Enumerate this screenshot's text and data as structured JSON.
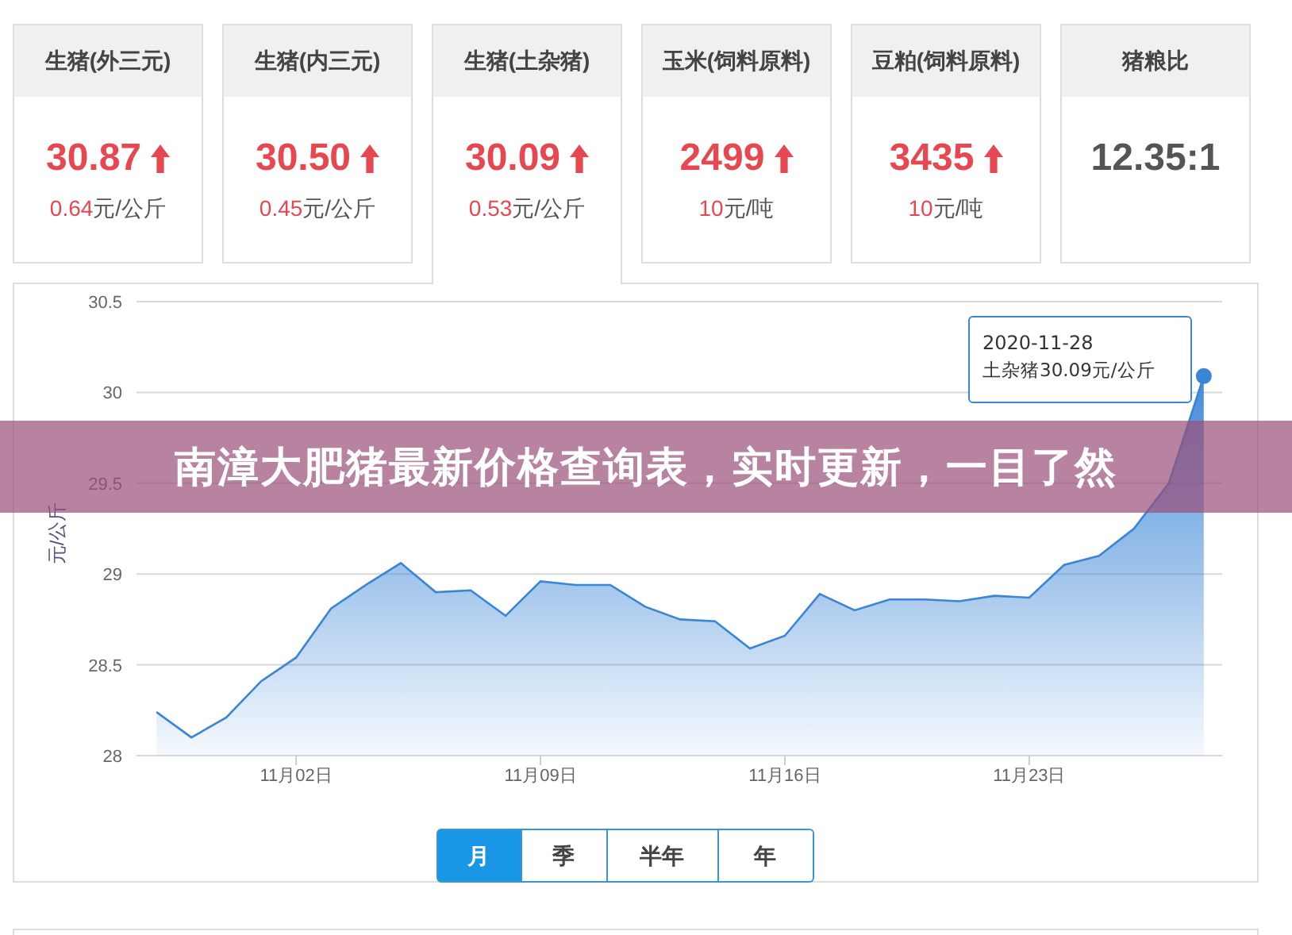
{
  "cards": [
    {
      "title": "生猪(外三元)",
      "value": "30.87",
      "kind": "up",
      "change": "0.64",
      "unit": "元/公斤",
      "selected": false
    },
    {
      "title": "生猪(内三元)",
      "value": "30.50",
      "kind": "up",
      "change": "0.45",
      "unit": "元/公斤",
      "selected": false
    },
    {
      "title": "生猪(土杂猪)",
      "value": "30.09",
      "kind": "up",
      "change": "0.53",
      "unit": "元/公斤",
      "selected": true
    },
    {
      "title": "玉米(饲料原料)",
      "value": "2499",
      "kind": "up",
      "change": "10",
      "unit": "元/吨",
      "selected": false
    },
    {
      "title": "豆粕(饲料原料)",
      "value": "3435",
      "kind": "up",
      "change": "10",
      "unit": "元/吨",
      "selected": false
    },
    {
      "title": "猪粮比",
      "value": "12.35:1",
      "kind": "none",
      "selected": false
    }
  ],
  "chart": {
    "tooltip": {
      "date": "2020-11-28",
      "text": "土杂猪30.09元/公斤"
    },
    "chart_data": {
      "type": "area",
      "ylabel": "元/公斤",
      "categories": [
        null,
        null,
        null,
        null,
        "11月02日",
        null,
        null,
        null,
        null,
        null,
        null,
        "11月09日",
        null,
        null,
        null,
        null,
        null,
        null,
        "11月16日",
        null,
        null,
        null,
        null,
        null,
        null,
        "11月23日",
        null,
        null,
        null,
        null,
        null
      ],
      "series": [
        {
          "color": "#3a85d6",
          "values": [
            28.24,
            28.1,
            28.21,
            28.41,
            28.54,
            28.81,
            28.94,
            29.06,
            28.9,
            28.91,
            28.77,
            28.96,
            28.94,
            28.94,
            28.82,
            28.75,
            28.74,
            28.59,
            28.66,
            28.89,
            28.8,
            28.86,
            28.86,
            28.85,
            28.88,
            28.87,
            29.05,
            29.1,
            29.25,
            29.5,
            30.09
          ]
        }
      ],
      "ylim": [
        28,
        30.5
      ],
      "grid": true,
      "yticks": [
        {
          "value": 28,
          "label": "28"
        },
        {
          "value": 28.5,
          "label": "28.5"
        },
        {
          "value": 29,
          "label": "29"
        },
        {
          "value": 29.5,
          "label": "29.5"
        },
        {
          "value": 30,
          "label": "30"
        },
        {
          "value": 30.5,
          "label": "30.5"
        }
      ]
    }
  },
  "ranges": [
    {
      "label": "月",
      "selected": true
    },
    {
      "label": "季",
      "selected": false
    },
    {
      "label": "半年",
      "selected": false
    },
    {
      "label": "年",
      "selected": false
    }
  ],
  "banner": "南漳大肥猪最新价格查询表，实时更新，一目了然"
}
